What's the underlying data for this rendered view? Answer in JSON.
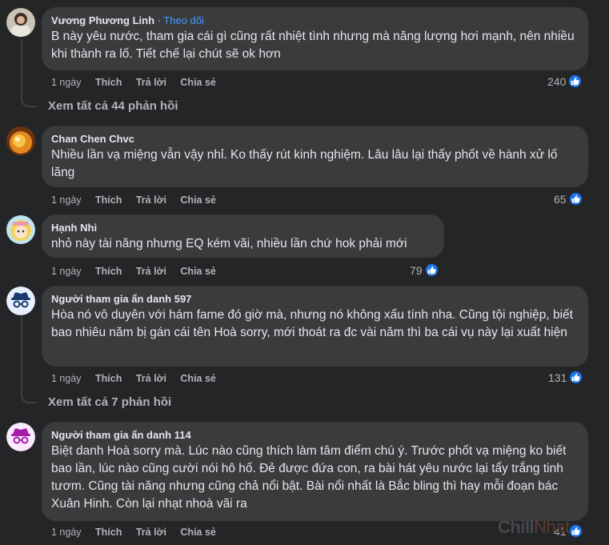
{
  "comments": [
    {
      "author": "Vương Phương Linh",
      "follow": "Theo dõi",
      "text": "B này yêu nước, tham gia cái gì cũng rất nhiệt tình nhưng mà năng lượng hơi mạnh, nên nhiều khi thành ra lố. Tiết chế lại chút sẽ ok hơn",
      "time": "1 ngày",
      "like": "Thích",
      "reply": "Trả lời",
      "share": "Chia sẻ",
      "reactions": "240"
    },
    {
      "author": "Chan Chen Chvc",
      "text": "Nhiều lần vạ miệng vẫn vậy nhỉ. Ko thấy rút kinh nghiệm. Lâu lâu lại thấy phốt về hành xử lố lăng",
      "time": "1 ngày",
      "like": "Thích",
      "reply": "Trả lời",
      "share": "Chia sẻ",
      "reactions": "65"
    },
    {
      "author": "Hạnh Nhi",
      "text": "nhỏ này tài năng nhưng EQ kém vãi, nhiều lần chứ hok phải mới",
      "time": "1 ngày",
      "like": "Thích",
      "reply": "Trả lời",
      "share": "Chia sẻ",
      "reactions": "79"
    },
    {
      "author": "Người tham gia ẩn danh 597",
      "text": "Hòa nó vô duyên với hám fame đó giờ mà, nhưng nó không xấu tính nha. Cũng tội nghiệp, biết bao nhiêu năm bị gán cái tên Hoà sorry, mới thoát ra đc vài năm thì ba cái vụ này lại xuất hiện",
      "time": "1 ngày",
      "like": "Thích",
      "reply": "Trả lời",
      "share": "Chia sẻ",
      "reactions": "131"
    },
    {
      "author": "Người tham gia ẩn danh 114",
      "text": "Biệt danh Hoà sorry mà. Lúc nào cũng thích làm tâm điểm chú ý. Trước phốt vạ miệng ko biết bao lần, lúc nào cũng cười nói hô hố. Đẻ được đứa con, ra bài hát yêu nước lại tẩy trắng tinh tươm. Cũng tài năng nhưng cũng chả nổi bật. Bài nổi nhất là Bắc bling thì hay mỗi đoạn bác Xuân Hinh. Còn lại nhạt nhoà vãi ra",
      "time": "1 ngày",
      "like": "Thích",
      "reply": "Trả lời",
      "share": "Chia sẻ",
      "reactions": "41"
    }
  ],
  "view_replies": [
    "Xem tất cả 44 phản hồi",
    "Xem tất cả 7 phản hồi"
  ],
  "watermark": {
    "part1": "Chill",
    "part2": "Nhat"
  },
  "colors": {
    "background": "#242526",
    "bubble": "#3a3b3c",
    "link": "#4599ff",
    "like": "#1877f2"
  }
}
